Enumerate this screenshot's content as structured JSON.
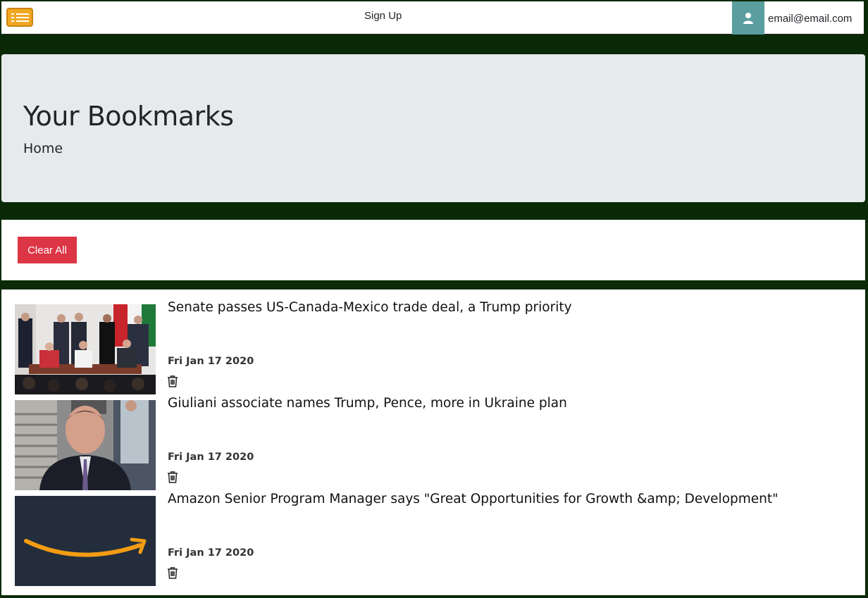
{
  "navbar": {
    "menu_icon": "menu-icon",
    "signup_label": "Sign Up",
    "user_icon": "user-icon",
    "user_email": "email@email.com"
  },
  "jumbotron": {
    "title": "Your Bookmarks",
    "breadcrumb": "Home"
  },
  "actions": {
    "clear_all_label": "Clear All"
  },
  "bookmarks": [
    {
      "title": "Senate passes US-Canada-Mexico trade deal, a Trump priority",
      "date": "Fri Jan 17 2020",
      "delete_icon": "trash-icon"
    },
    {
      "title": "Giuliani associate names Trump, Pence, more in Ukraine plan",
      "date": "Fri Jan 17 2020",
      "delete_icon": "trash-icon"
    },
    {
      "title": "Amazon Senior Program Manager says \"Great Opportunities for Growth &amp; Development\"",
      "date": "Fri Jan 17 2020",
      "delete_icon": "trash-icon"
    }
  ],
  "colors": {
    "page_bg": "#0a2a07",
    "menu_accent": "#f2a722",
    "user_box": "#5a9ea0",
    "danger": "#dc3545",
    "jumbotron_bg": "#e7eaed"
  }
}
